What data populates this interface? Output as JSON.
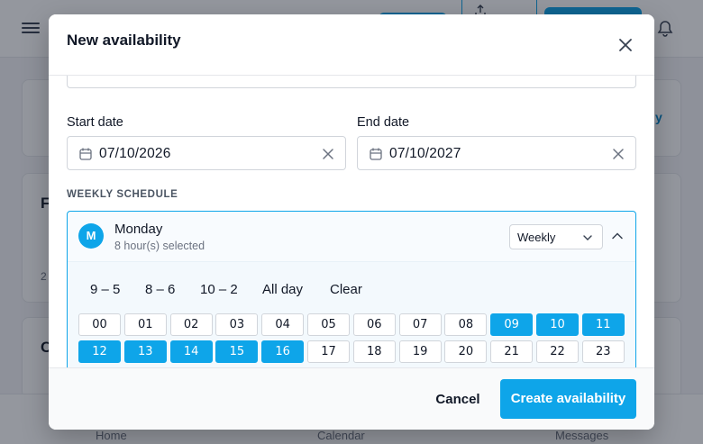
{
  "background": {
    "bottom_nav": [
      "Home",
      "Calendar",
      "Messages"
    ],
    "letters": [
      "F",
      "C"
    ],
    "count": "2",
    "link": "y"
  },
  "modal": {
    "title": "New availability",
    "start_date": {
      "label": "Start date",
      "value": "07/10/2026"
    },
    "end_date": {
      "label": "End date",
      "value": "07/10/2027"
    },
    "weekly_schedule_label": "WEEKLY SCHEDULE",
    "day": {
      "initial": "M",
      "name": "Monday",
      "summary": "8 hour(s) selected",
      "frequency": "Weekly"
    },
    "presets": [
      "9 – 5",
      "8 – 6",
      "10 – 2",
      "All day",
      "Clear"
    ],
    "hours": [
      {
        "label": "00",
        "selected": false
      },
      {
        "label": "01",
        "selected": false
      },
      {
        "label": "02",
        "selected": false
      },
      {
        "label": "03",
        "selected": false
      },
      {
        "label": "04",
        "selected": false
      },
      {
        "label": "05",
        "selected": false
      },
      {
        "label": "06",
        "selected": false
      },
      {
        "label": "07",
        "selected": false
      },
      {
        "label": "08",
        "selected": false
      },
      {
        "label": "09",
        "selected": true
      },
      {
        "label": "10",
        "selected": true
      },
      {
        "label": "11",
        "selected": true
      },
      {
        "label": "12",
        "selected": true
      },
      {
        "label": "13",
        "selected": true
      },
      {
        "label": "14",
        "selected": true
      },
      {
        "label": "15",
        "selected": true
      },
      {
        "label": "16",
        "selected": true
      },
      {
        "label": "17",
        "selected": false
      },
      {
        "label": "18",
        "selected": false
      },
      {
        "label": "19",
        "selected": false
      },
      {
        "label": "20",
        "selected": false
      },
      {
        "label": "21",
        "selected": false
      },
      {
        "label": "22",
        "selected": false
      },
      {
        "label": "23",
        "selected": false
      }
    ],
    "cancel_label": "Cancel",
    "create_label": "Create availability"
  },
  "colors": {
    "accent": "#0ea5e9",
    "overlay": "rgba(17,24,39,0.45)"
  }
}
